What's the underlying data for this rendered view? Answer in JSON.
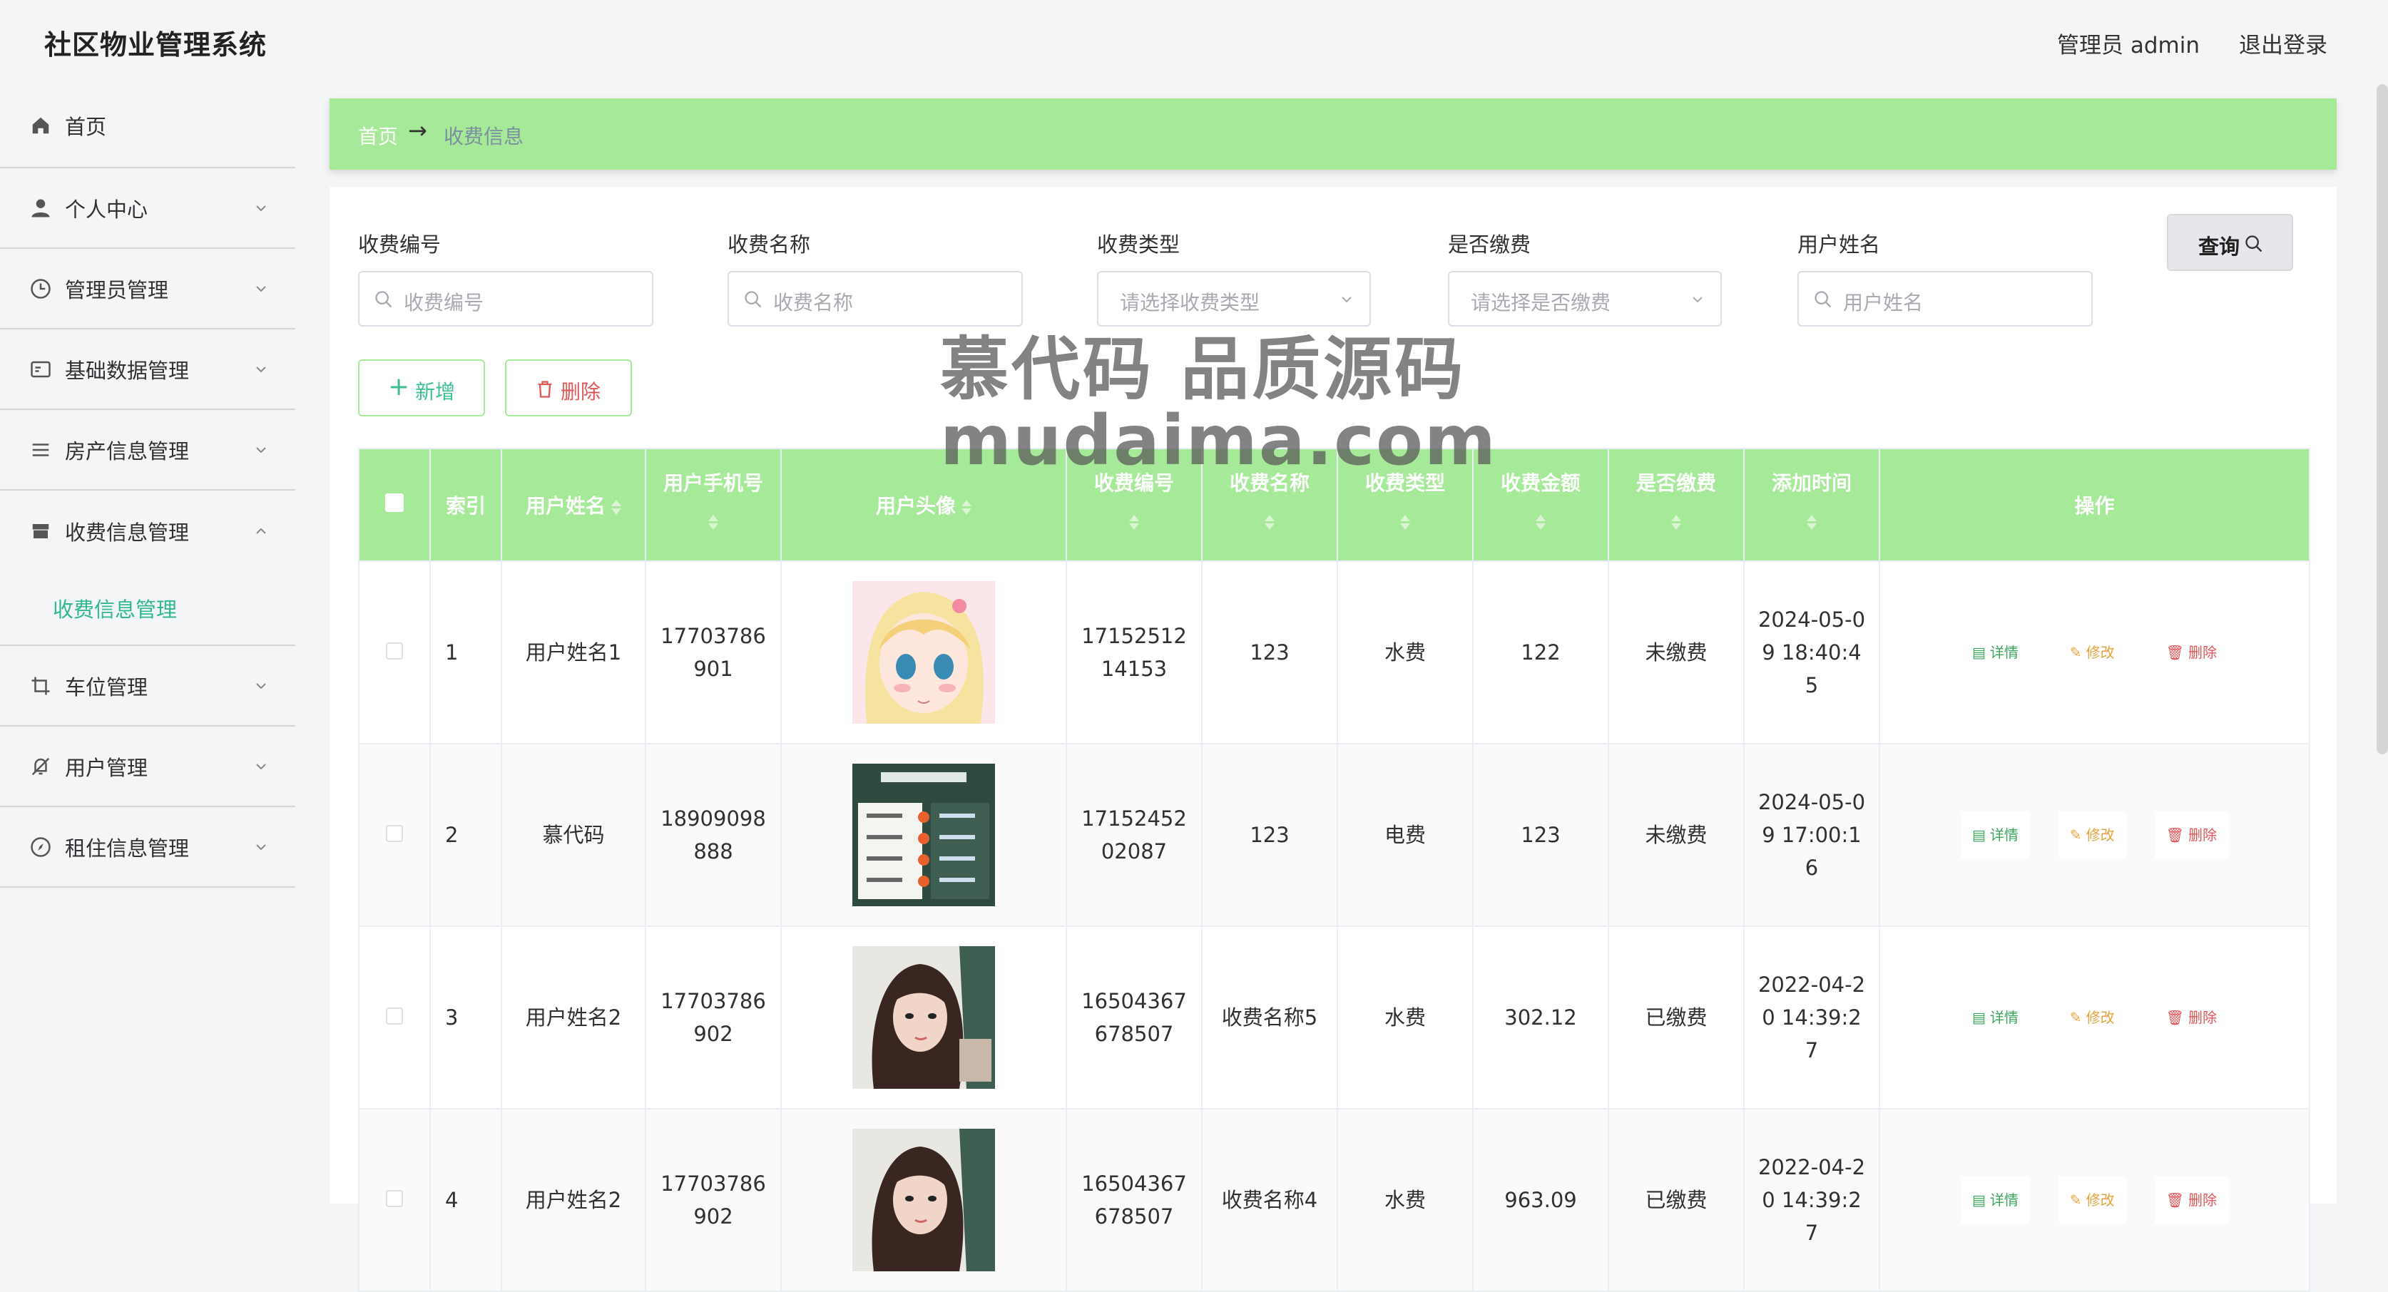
{
  "header": {
    "title": "社区物业管理系统",
    "user": "管理员 admin",
    "logout": "退出登录"
  },
  "sidebar": {
    "items": [
      {
        "label": "首页",
        "icon": "home-icon",
        "expandable": false
      },
      {
        "label": "个人中心",
        "icon": "user-icon",
        "expandable": true
      },
      {
        "label": "管理员管理",
        "icon": "clock-icon",
        "expandable": true
      },
      {
        "label": "基础数据管理",
        "icon": "id-card-icon",
        "expandable": true
      },
      {
        "label": "房产信息管理",
        "icon": "list-icon",
        "expandable": true
      },
      {
        "label": "收费信息管理",
        "icon": "shop-icon",
        "expandable": true,
        "expanded": true
      },
      {
        "label": "车位管理",
        "icon": "crop-icon",
        "expandable": true
      },
      {
        "label": "用户管理",
        "icon": "bell-off-icon",
        "expandable": true
      },
      {
        "label": "租住信息管理",
        "icon": "compass-icon",
        "expandable": true
      }
    ],
    "submenu": {
      "label": "收费信息管理"
    }
  },
  "breadcrumb": {
    "home": "首页",
    "current": "收费信息"
  },
  "filters": {
    "fee_no": {
      "label": "收费编号",
      "placeholder": "收费编号"
    },
    "fee_name": {
      "label": "收费名称",
      "placeholder": "收费名称"
    },
    "fee_type": {
      "label": "收费类型",
      "placeholder": "请选择收费类型"
    },
    "paid": {
      "label": "是否缴费",
      "placeholder": "请选择是否缴费"
    },
    "username": {
      "label": "用户姓名",
      "placeholder": "用户姓名"
    },
    "query_button": "查询"
  },
  "actions": {
    "add": "新增",
    "delete": "删除"
  },
  "watermark": {
    "line1": "慕代码 品质源码",
    "line2": "mudaima.com"
  },
  "table": {
    "columns": [
      "索引",
      "用户姓名",
      "用户手机号",
      "用户头像",
      "收费编号",
      "收费名称",
      "收费类型",
      "收费金额",
      "是否缴费",
      "添加时间",
      "操作"
    ],
    "op_labels": {
      "detail": "详情",
      "edit": "修改",
      "delete": "删除"
    },
    "rows": [
      {
        "index": "1",
        "name": "用户姓名1",
        "phone": "17703786901",
        "avatar": "anime-girl",
        "fee_no": "1715251214153",
        "fee_name": "123",
        "fee_type": "水费",
        "amount": "122",
        "paid": "未缴费",
        "time": "2024-05-09 18:40:45"
      },
      {
        "index": "2",
        "name": "慕代码",
        "phone": "18909098888",
        "avatar": "poster",
        "fee_no": "1715245202087",
        "fee_name": "123",
        "fee_type": "电费",
        "amount": "123",
        "paid": "未缴费",
        "time": "2024-05-09 17:00:16"
      },
      {
        "index": "3",
        "name": "用户姓名2",
        "phone": "17703786902",
        "avatar": "woman-portrait",
        "fee_no": "16504367678507",
        "fee_name": "收费名称5",
        "fee_type": "水费",
        "amount": "302.12",
        "paid": "已缴费",
        "time": "2022-04-20 14:39:27"
      },
      {
        "index": "4",
        "name": "用户姓名2",
        "phone": "17703786902",
        "avatar": "woman-portrait",
        "fee_no": "16504367678507",
        "fee_name": "收费名称4",
        "fee_type": "水费",
        "amount": "963.09",
        "paid": "已缴费",
        "time": "2022-04-20 14:39:27"
      }
    ]
  },
  "colors": {
    "accent": "#a6e998",
    "active_text": "#30b88f",
    "danger": "#e05555",
    "warn": "#e6a23c",
    "success": "#3aa55a"
  }
}
